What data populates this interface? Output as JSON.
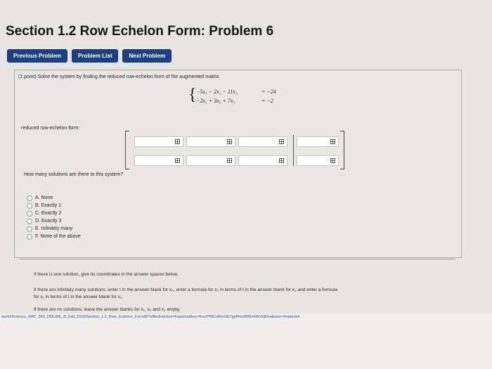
{
  "page": {
    "title": "Section 1.2 Row Echelon Form: Problem 6"
  },
  "nav": {
    "previous": "Previous Problem",
    "list": "Problem List",
    "next": "Next Problem"
  },
  "problem": {
    "prompt": "(1 point) Solve the system by finding the reduced row-echelon form of the augmented matrix.",
    "system": {
      "eq1": "−5x₁ − 2x₂ − 11x₃",
      "rhs1": "= −24",
      "eq2": "−2x₁ + 3x₂ + 7x₃",
      "rhs2": "= −2"
    },
    "rref_label": "reduced row-echelon form:",
    "question": "How many solutions are there to this system?",
    "options": [
      "A. None",
      "B. Exactly 1",
      "C. Exactly 2",
      "D. Exactly 3",
      "E. Infinitely many",
      "F. None of the above"
    ]
  },
  "notes": {
    "n1": "If there is one solution, give its coordinates in the answer spaces below.",
    "n2": "If there are infinitely many solutions, enter t in the answer blank for x₃, enter a formula for x₂ in terms of t in the answer blank for x₂ and enter a formula",
    "n3": "for x₁ in terms of t in the answer blank for x₁.",
    "n4": "If there are no solutions, leave the answer blanks for x₁, x₂ and x₃ empty."
  },
  "statusbar": {
    "url": "work2/lonescu_MAT_343_ONLINE_B_Fall_2018/Section_1.2_Row_Echelon_Form/6/?effectiveUser=ksparris&key=6rscPINCsRmOE7gpPhm2MIU43kV9jDva&user=ksparris#"
  }
}
